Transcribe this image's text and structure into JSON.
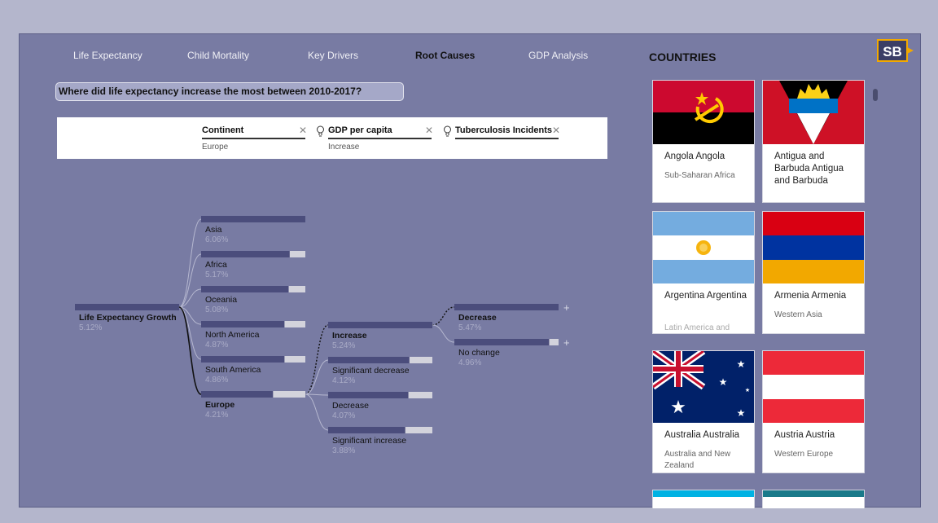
{
  "tabs": [
    {
      "label": "Life Expectancy",
      "active": false
    },
    {
      "label": "Child Mortality",
      "active": false
    },
    {
      "label": "Key Drivers",
      "active": false
    },
    {
      "label": "Root Causes",
      "active": true
    },
    {
      "label": "GDP Analysis",
      "active": false
    }
  ],
  "countries_title": "COUNTRIES",
  "logo_text": "SB",
  "question": "Where did life expectancy increase the most between 2010-2017?",
  "filters": [
    {
      "name": "Continent",
      "value": "Europe",
      "icon": "close-icon"
    },
    {
      "name": "GDP per capita",
      "value": "Increase",
      "icon": "lightbulb-icon"
    },
    {
      "name": "Tuberculosis Incidents",
      "value": "",
      "icon": "lightbulb-icon"
    }
  ],
  "decomposition_tree": {
    "root": {
      "label": "Life Expectancy Growth",
      "value": "5.12%",
      "fill": 1.0
    },
    "level1": [
      {
        "label": "Asia",
        "value": "6.06%",
        "fill": 1.0
      },
      {
        "label": "Africa",
        "value": "5.17%",
        "fill": 0.85
      },
      {
        "label": "Oceania",
        "value": "5.08%",
        "fill": 0.84
      },
      {
        "label": "North America",
        "value": "4.87%",
        "fill": 0.8
      },
      {
        "label": "South America",
        "value": "4.86%",
        "fill": 0.8
      },
      {
        "label": "Europe",
        "value": "4.21%",
        "fill": 0.69,
        "selected": true
      }
    ],
    "level2": [
      {
        "label": "Increase",
        "value": "5.24%",
        "fill": 1.0,
        "selected": true
      },
      {
        "label": "Significant decrease",
        "value": "4.12%",
        "fill": 0.78
      },
      {
        "label": "Decrease",
        "value": "4.07%",
        "fill": 0.77
      },
      {
        "label": "Significant increase",
        "value": "3.88%",
        "fill": 0.74
      }
    ],
    "level3": [
      {
        "label": "Decrease",
        "value": "5.47%",
        "fill": 1.0,
        "bold": true
      },
      {
        "label": "No change",
        "value": "4.96%",
        "fill": 0.91,
        "bold": false
      }
    ],
    "expand_symbol": "+"
  },
  "country_cards": [
    {
      "name": "Angola Angola",
      "region": "Sub-Saharan Africa",
      "flag": "angola-flag"
    },
    {
      "name": "Antigua and Barbuda Antigua and Barbuda",
      "region": "",
      "flag": "antigua-flag"
    },
    {
      "name": "Argentina Argentina",
      "region": "Latin America and",
      "flag": "argentina-flag"
    },
    {
      "name": "Armenia Armenia",
      "region": "Western Asia",
      "flag": "armenia-flag"
    },
    {
      "name": "Australia Australia",
      "region": "Australia and New Zealand",
      "flag": "australia-flag"
    },
    {
      "name": "Austria Austria",
      "region": "Western Europe",
      "flag": "austria-flag"
    }
  ],
  "colors": {
    "panel_bg": "#787ba3",
    "bar_fill": "#4b4d7c",
    "bar_track": "#d3d3dc",
    "value_text": "#a9abc6"
  }
}
